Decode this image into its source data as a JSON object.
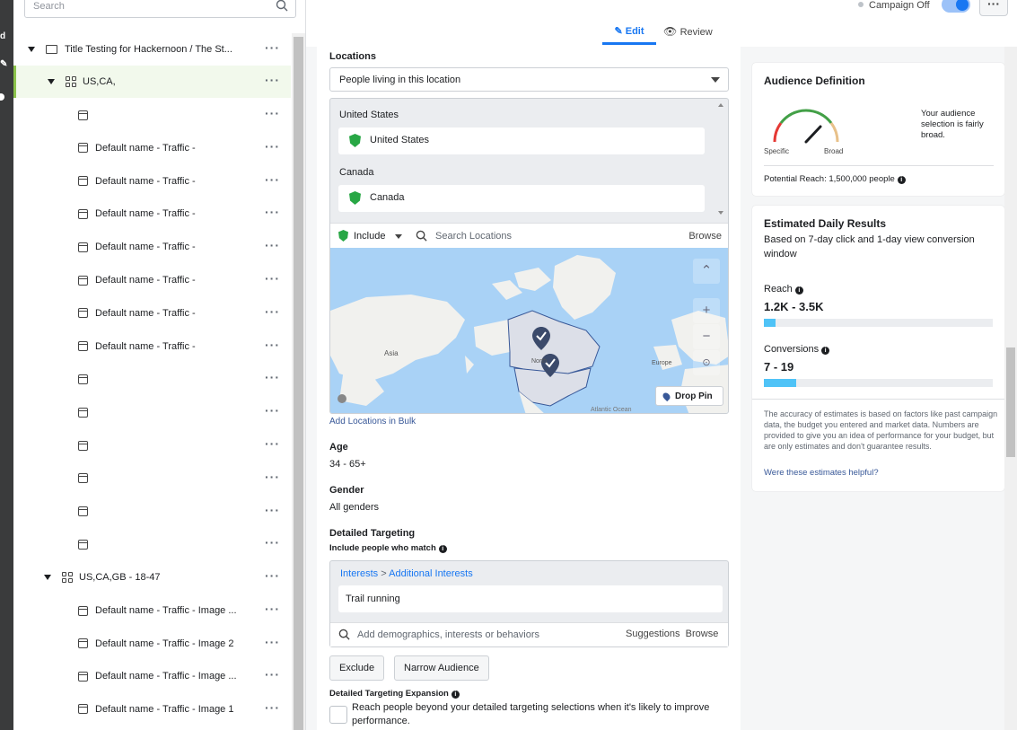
{
  "tree": {
    "search_placeholder": "Search",
    "campaign": "Title Testing for Hackernoon / The St...",
    "adset1": "US,CA,",
    "adset1_ads": [
      "",
      "Default name - Traffic -",
      "Default name - Traffic -",
      "Default name - Traffic -",
      "Default name - Traffic -",
      "Default name - Traffic -",
      "Default name - Traffic -",
      "Default name - Traffic -",
      "",
      "",
      "",
      "",
      "",
      ""
    ],
    "adset2": "US,CA,GB - 18-47",
    "adset2_ads": [
      "Default name - Traffic - Image ...",
      "Default name - Traffic - Image 2",
      "Default name - Traffic - Image ...",
      "Default name - Traffic - Image 1"
    ]
  },
  "topbar": {
    "edit": "Edit",
    "review": "Review",
    "campaign_status": "Campaign Off",
    "campaign_on": false
  },
  "form": {
    "locations_label": "Locations",
    "location_type": "People living in this location",
    "groups": [
      {
        "name": "United States",
        "item": "United States"
      },
      {
        "name": "Canada",
        "item": "Canada"
      }
    ],
    "include": "Include",
    "search_locations": "Search Locations",
    "browse": "Browse",
    "map_labels": {
      "asia": "Asia",
      "north_america": "North",
      "europe": "Europe",
      "atlantic": "Atlantic Ocean"
    },
    "drop_pin": "Drop Pin",
    "add_bulk": "Add Locations in Bulk",
    "age_label": "Age",
    "age_value": "34 - 65+",
    "gender_label": "Gender",
    "gender_value": "All genders",
    "dt_label": "Detailed Targeting",
    "dt_sub": "Include people who match",
    "crumb_a": "Interests",
    "crumb_sep": ">",
    "crumb_b": "Additional Interests",
    "interest": "Trail running",
    "add_placeholder": "Add demographics, interests or behaviors",
    "suggestions": "Suggestions",
    "browse2": "Browse",
    "exclude": "Exclude",
    "narrow": "Narrow Audience",
    "expansion_label": "Detailed Targeting Expansion",
    "expansion_text": "Reach people beyond your detailed targeting selections when it's likely to improve performance."
  },
  "audience": {
    "title": "Audience Definition",
    "specific": "Specific",
    "broad": "Broad",
    "desc": "Your audience selection is fairly broad.",
    "potential": "Potential Reach: 1,500,000 people"
  },
  "results": {
    "title": "Estimated Daily Results",
    "sub": "Based on 7-day click and 1-day view conversion window",
    "reach_label": "Reach",
    "reach_value": "1.2K - 3.5K",
    "reach_fill_pct": 5,
    "conv_label": "Conversions",
    "conv_value": "7 - 19",
    "conv_fill_pct": 14,
    "note": "The accuracy of estimates is based on factors like past campaign data, the budget you entered and market data. Numbers are provided to give you an idea of performance for your budget, but are only estimates and don't guarantee results.",
    "helpful": "Were these estimates helpful?"
  },
  "colors": {
    "accent": "#1877f2",
    "progress": "#4fc3f7",
    "include_green": "#28a745",
    "gauge_red": "#e53935",
    "gauge_green": "#43a047",
    "gauge_tan": "#e8c18a"
  }
}
